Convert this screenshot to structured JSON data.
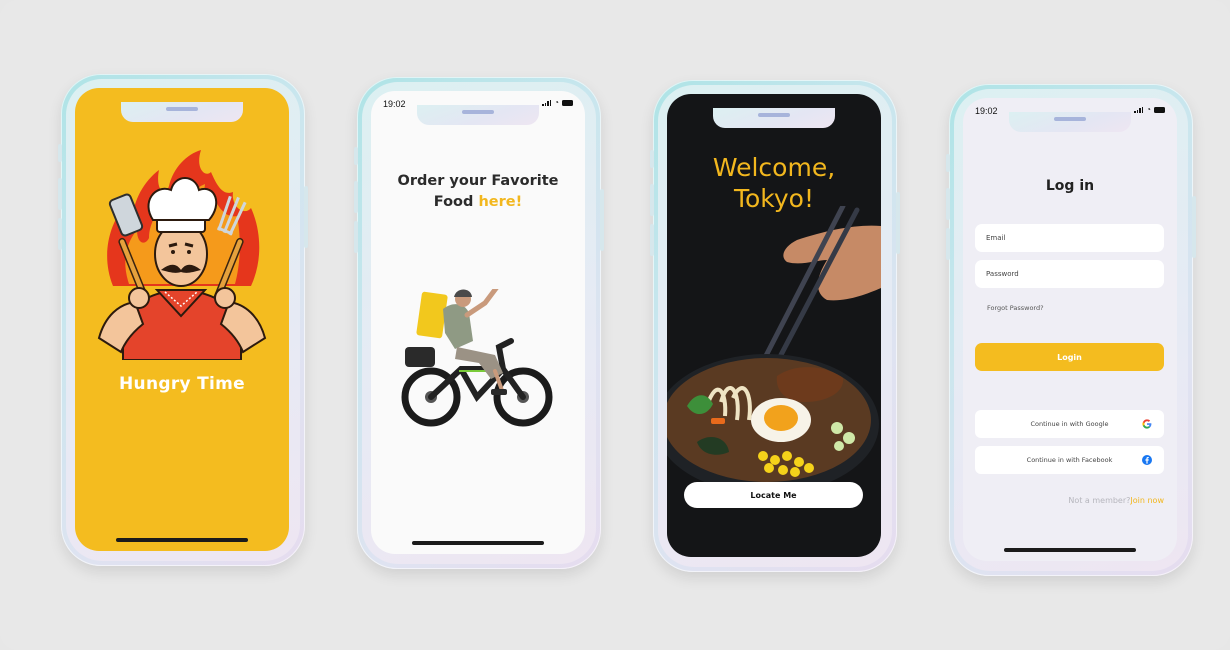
{
  "colors": {
    "accent_yellow": "#f4bc1f",
    "background": "#e8e8e8",
    "screen_dark": "#141517",
    "screen_light": "#fafafa",
    "screen_login": "#efeef5"
  },
  "phones": [
    {
      "screen": "splash",
      "brand_name": "Hungry Time",
      "illustration": "chef-with-spatula-and-fork-on-fire"
    },
    {
      "screen": "onboarding",
      "status_time": "19:02",
      "heading_part1": "Order your Favorite",
      "heading_part2": "Food ",
      "heading_accent": "here!",
      "illustration": "delivery-rider-on-bicycle"
    },
    {
      "screen": "welcome",
      "welcome_line1": "Welcome,",
      "welcome_line2": "Tokyo!",
      "illustration": "ramen-bowl-with-chopsticks",
      "locate_button": "Locate Me"
    },
    {
      "screen": "login",
      "status_time": "19:02",
      "title": "Log in",
      "email_placeholder": "Email",
      "password_placeholder": "Password",
      "forgot_password": "Forgot Password?",
      "login_button": "Login",
      "google_button": "Continue in with Google",
      "facebook_button": "Continue in with Facebook",
      "not_member": "Not a member?",
      "join_now": "Join now"
    }
  ]
}
